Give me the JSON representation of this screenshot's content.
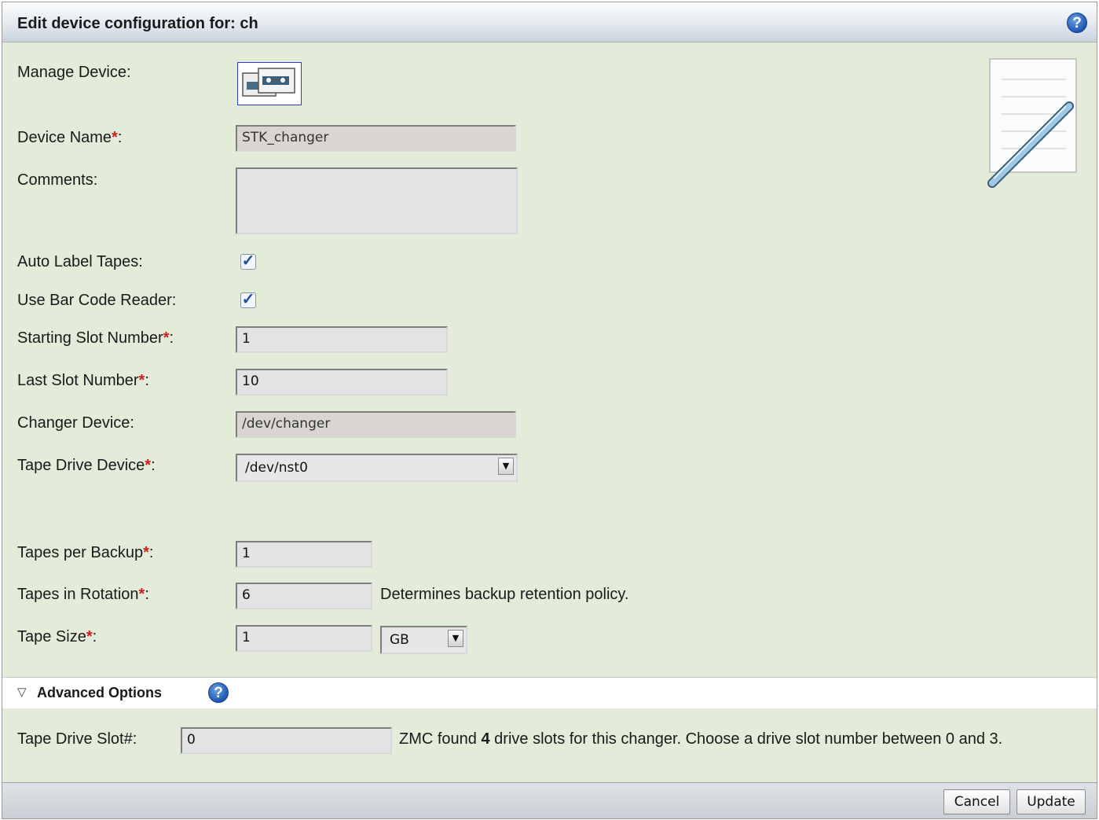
{
  "header": {
    "title": "Edit device configuration for: ch",
    "help_icon": "question-circle-icon"
  },
  "form": {
    "manage_device_label": "Manage Device:",
    "manage_device_icon": "tape-cartridges-icon",
    "device_name_label": "Device Name",
    "device_name_value": "STK_changer",
    "comments_label": "Comments:",
    "comments_value": "",
    "auto_label_label": "Auto Label Tapes:",
    "auto_label_checked": true,
    "barcode_label": "Use Bar Code Reader:",
    "barcode_checked": true,
    "start_slot_label": "Starting Slot Number",
    "start_slot_value": "1",
    "last_slot_label": "Last Slot Number",
    "last_slot_value": "10",
    "changer_device_label": "Changer Device:",
    "changer_device_value": "/dev/changer",
    "tape_drive_label": "Tape Drive Device",
    "tape_drive_value": "/dev/nst0",
    "tapes_per_backup_label": "Tapes per Backup",
    "tapes_per_backup_value": "1",
    "tapes_rotation_label": "Tapes in Rotation",
    "tapes_rotation_value": "6",
    "tapes_rotation_note": "Determines backup retention policy.",
    "tape_size_label": "Tape Size",
    "tape_size_value": "1",
    "tape_size_unit": "GB",
    "required_mark": "*",
    "colon": ":"
  },
  "advanced": {
    "title": "Advanced Options",
    "drive_slot_label": "Tape Drive Slot#:",
    "drive_slot_value": "0",
    "note_prefix": "ZMC found ",
    "note_count": "4",
    "note_suffix": " drive slots for this changer. Choose a drive slot number between 0 and 3."
  },
  "footer": {
    "cancel_label": "Cancel",
    "update_label": "Update"
  },
  "colors": {
    "panel_bg": "#e3ebd9",
    "required": "#d21a1a",
    "help_blue": "#1e56b3"
  }
}
